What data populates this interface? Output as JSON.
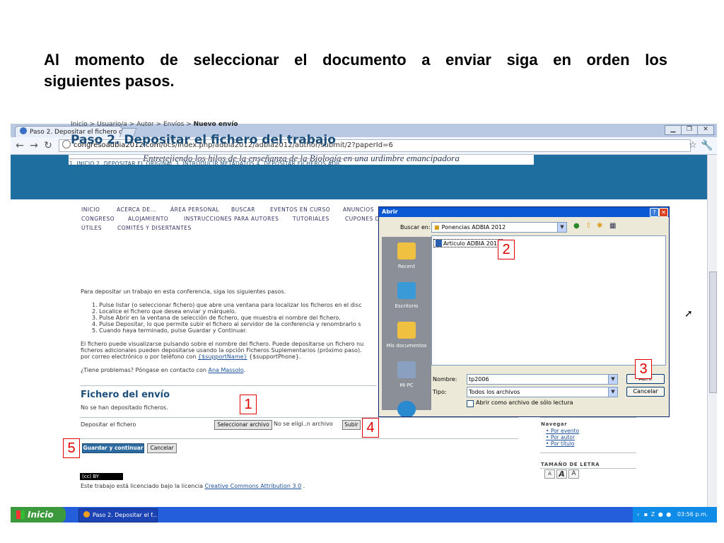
{
  "slide": {
    "title_line1": "Al momento de seleccionar el documento a enviar siga en orden los",
    "title_line2": "siguientes pasos."
  },
  "browser": {
    "tab_title": "Paso 2. Depositar el fichero de",
    "url_host": "congresoadbia2012.com",
    "url_path": "/ocs/index.php/adbia2012/adbia2012/author/submit/2?paperId=6",
    "banner_text": "Entretejiendo los hilos de la enseñanza de la Biología en una urdimbre emancipadora"
  },
  "site": {
    "menu_row1": [
      "INICIO",
      "ACERCA DE...",
      "ÁREA PERSONAL",
      "BUSCAR",
      "EVENTOS EN CURSO",
      "ANUNCIOS"
    ],
    "menu_row2": [
      "CONGRESO",
      "ALOJAMIENTO",
      "INSTRUCCIONES PARA AUTORES",
      "TUTORIALES",
      "CUPONES D"
    ],
    "menu_row3": [
      "ÚTILES",
      "COMITÉS Y DISERTANTES"
    ],
    "breadcrumb": "Inicio > Usuario/a > Autor > Envíos > ",
    "breadcrumb_current": "Nuevo envío",
    "page_title": "Paso 2. Depositar el fichero del trabajo",
    "steps_bar": "1. INICIO  2. DEPOSITAR EL ORIGINAL  3. INTRODUCIR METADATOS  4. DEPOSITAR FICHEROS ADIC",
    "intro": "Para depositar un trabajo en esta conferencia, siga los siguientes pasos.",
    "instructions": [
      "1.  Pulse listar (o seleccionar fichero) que abre una ventana para localizar los ficheros en el disc",
      "2.  Localice el fichero que desea enviar y márquelo.",
      "3.  Pulse Abrir en la ventana de selección de fichero, que muestra el nombre del fichero.",
      "4.  Pulse Depositar, lo que permite subir el fichero al servidor de la conferencia y renombrarlo s",
      "5.  Cuando haya terminado, pulse Guardar y Continuar."
    ],
    "para2_line1": "El fichero puede visualizarse pulsando sobre el nombre del fichero. Puede depositarse un fichero nu",
    "para2_line2": "ficheros adicionales pueden depositarse usando la opción Ficheros Suplementarios (próximo paso).",
    "para2_line3_pre": "por correo electrónico o por teléfono con ",
    "para2_line3_link": "{$supportName}",
    "para2_line3_post": " {$supportPhone}.",
    "problems_pre": "¿Tiene problemas? Póngase en contacto con ",
    "problems_link": "Ana Massolo",
    "problems_post": ".",
    "section_title": "Fichero del envío",
    "no_files": "No se han depositado ficheros.",
    "upload_label": "Depositar el fichero",
    "select_button": "Seleccionar archivo",
    "no_file_chosen": "No se eligi..n archivo",
    "upload_button": "Subir",
    "save_continue_button": "Guardar y continuar",
    "cancel_button": "Cancelar",
    "cc_badge": "(cc) BY",
    "license_pre": "Este trabajo está licenciado bajo la licencia ",
    "license_link": "Creative Commons Attribution 3.0",
    "license_post": " ."
  },
  "sidebar": {
    "navigate_title": "Navegar",
    "navigate_links": [
      "Por evento",
      "Por autor",
      "Por título"
    ],
    "font_size_title": "TAMAÑO DE LETRA",
    "font_sizes": [
      "A",
      "A",
      "A"
    ]
  },
  "dialog": {
    "title": "Abrir",
    "look_in_label": "Buscar en:",
    "look_in_value": "Ponencias ADBIA 2012",
    "places": [
      "Recent",
      "Escritorio",
      "Mis documentos",
      "Mi PC"
    ],
    "file_item": "Articulo ADBIA 2012",
    "filename_label": "Nombre:",
    "filename_value": "tp2006",
    "filetype_label": "Tipo:",
    "filetype_value": "Todos los archivos",
    "readonly_label": "Abrir como archivo de sólo lectura",
    "open_button": "Abrir",
    "cancel_button": "Cancelar"
  },
  "markers": [
    "1",
    "2",
    "3",
    "4",
    "5"
  ],
  "taskbar": {
    "start_label": "Inicio",
    "task_label": "Paso 2. Depositar el f...",
    "clock": "03:56 p.m."
  },
  "colors": {
    "site_blue": "#1e6f9f",
    "heading_blue": "#1d4f7a",
    "marker_red": "#e00000",
    "xp_taskbar": "#245edb"
  }
}
